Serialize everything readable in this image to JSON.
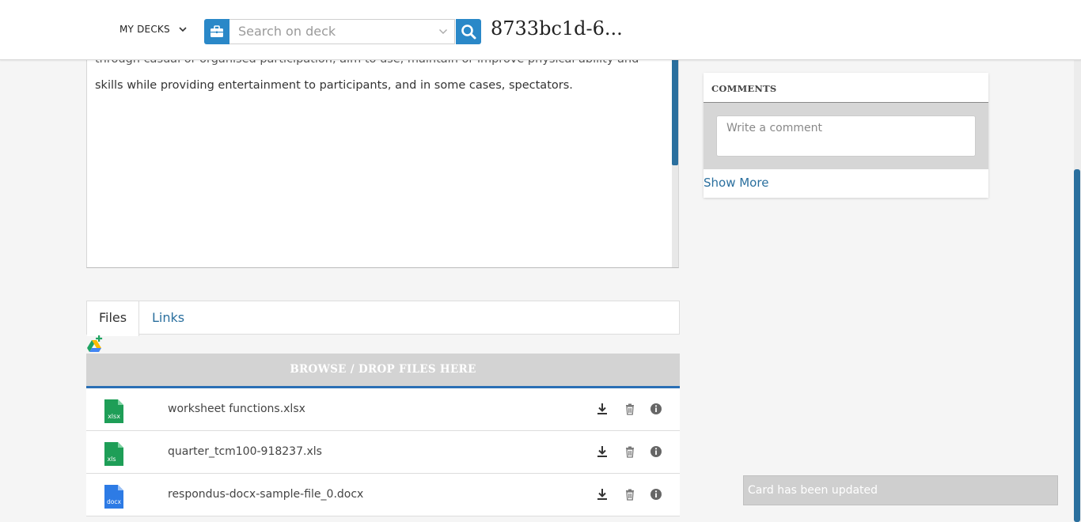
{
  "header": {
    "my_decks_label": "MY DECKS",
    "search_placeholder": "Search on deck",
    "deck_title": "8733bc1d-6..."
  },
  "description": {
    "lines": [
      "through casual or organised participation, aim to use, maintain or improve physical ability and",
      "skills while providing entertainment to participants, and in some cases, spectators."
    ]
  },
  "comments": {
    "heading": "COMMENTS",
    "input_placeholder": "Write a comment",
    "show_more": "Show More"
  },
  "attachments": {
    "tabs": [
      {
        "label": "Files",
        "active": true
      },
      {
        "label": "Links",
        "active": false
      }
    ],
    "dropzone_label": "BROWSE / DROP FILES HERE",
    "files": [
      {
        "name": "worksheet functions.xlsx",
        "ext": "xlsx",
        "color": "#1e9e57"
      },
      {
        "name": "quarter_tcm100-918237.xls",
        "ext": "xls",
        "color": "#1e9e57"
      },
      {
        "name": "respondus-docx-sample-file_0.docx",
        "ext": "docx",
        "color": "#2d7be5"
      }
    ]
  },
  "toast": {
    "message": "Card has been updated"
  },
  "colors": {
    "accent": "#2a88c8",
    "link": "#2a6f9e",
    "dropzone_border": "#2a6fb5"
  }
}
